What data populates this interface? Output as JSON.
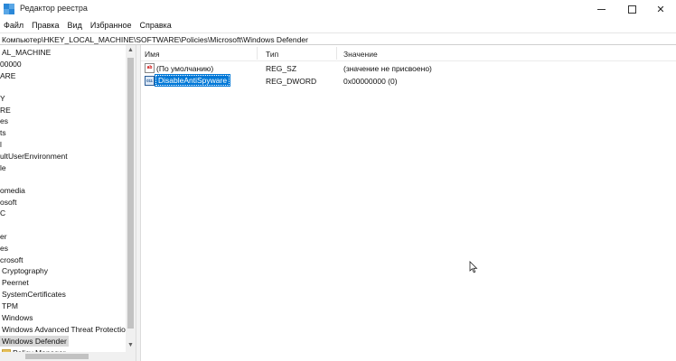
{
  "window": {
    "title": "Редактор реестра",
    "controls": {
      "minimize": "minimize-icon",
      "maximize": "maximize-icon",
      "close": "close-icon"
    }
  },
  "menu": {
    "items": [
      "Файл",
      "Правка",
      "Вид",
      "Избранное",
      "Справка"
    ]
  },
  "address": {
    "path": "Компьютер\\HKEY_LOCAL_MACHINE\\SOFTWARE\\Policies\\Microsoft\\Windows Defender"
  },
  "tree": {
    "items": [
      "AL_MACHINE",
      "00000",
      "ARE",
      "Y",
      "RE",
      "es",
      "ts",
      "l",
      "ultUserEnvironment",
      "le",
      "omedia",
      "osoft",
      "C",
      "er",
      "es",
      "crosoft",
      "Cryptography",
      "Peernet",
      "SystemCertificates",
      "TPM",
      "Windows",
      "Windows Advanced Threat Protection",
      "Windows Defender",
      "Policy Manager"
    ],
    "selected": "Windows Defender"
  },
  "list": {
    "columns": [
      "Имя",
      "Тип",
      "Значение"
    ],
    "rows": [
      {
        "name": "(По умолчанию)",
        "type": "REG_SZ",
        "value": "(значение не присвоено)",
        "icon": "string-value-icon"
      },
      {
        "name": "DisableAntiSpyware",
        "type": "REG_DWORD",
        "value": "0x00000000 (0)",
        "icon": "binary-value-icon"
      }
    ]
  },
  "colors": {
    "selection": "#0078d7",
    "tree_selection": "#d9d9d9",
    "folder": "#e8c25d"
  }
}
